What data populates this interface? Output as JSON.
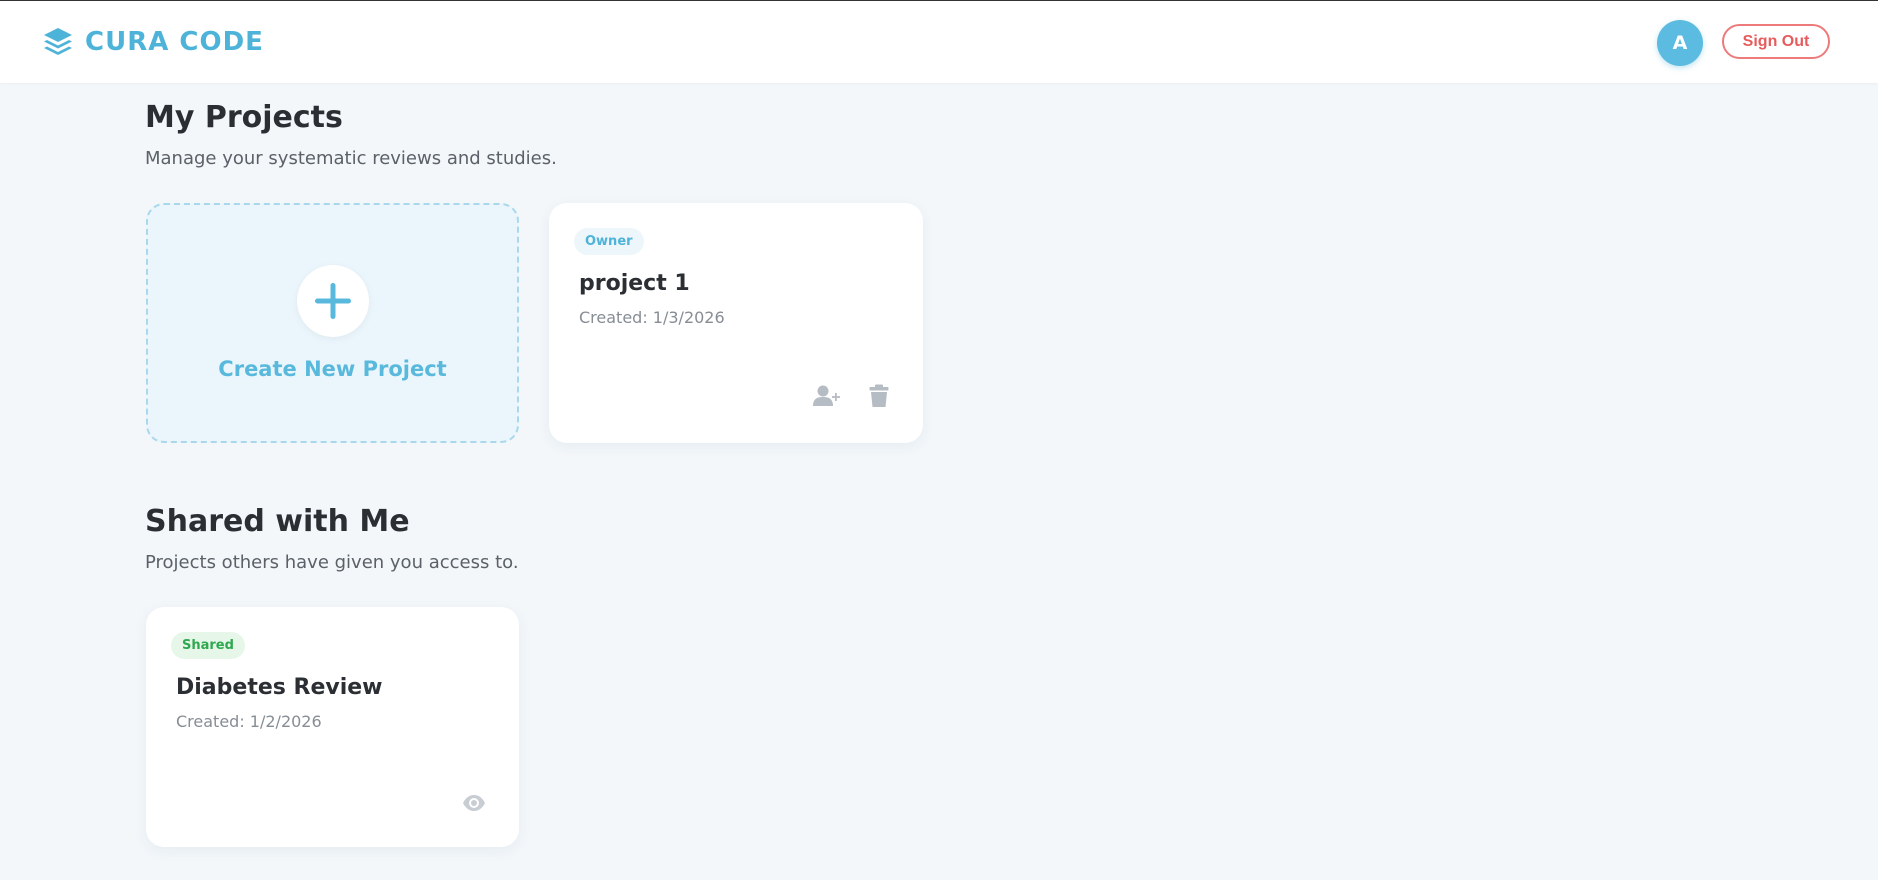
{
  "app": {
    "brand": "CURA CODE",
    "avatar_initial": "A",
    "signout_label": "Sign Out",
    "accent_color": "#4eb3d8",
    "signout_color": "#e65c5c"
  },
  "my_projects": {
    "title": "My Projects",
    "subtitle": "Manage your systematic reviews and studies.",
    "create_label": "Create New Project",
    "items": [
      {
        "badge": "Owner",
        "name": "project 1",
        "created": "Created: 1/3/2026",
        "icons": [
          "add-user-icon",
          "trash-icon"
        ]
      }
    ]
  },
  "shared": {
    "title": "Shared with Me",
    "subtitle": "Projects others have given you access to.",
    "items": [
      {
        "badge": "Shared",
        "name": "Diabetes Review",
        "created": "Created: 1/2/2026",
        "icons": [
          "eye-icon"
        ]
      }
    ]
  }
}
